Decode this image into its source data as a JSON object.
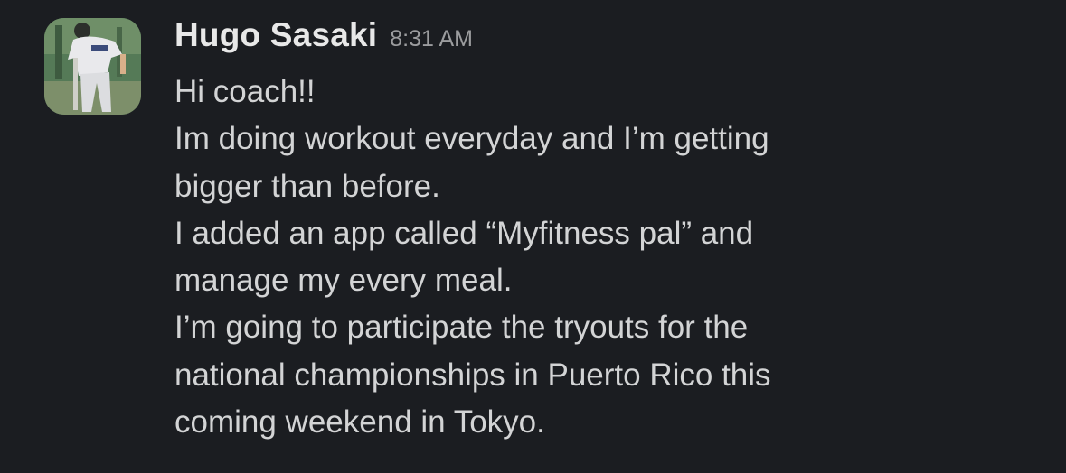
{
  "message": {
    "sender": "Hugo Sasaki",
    "timestamp": "8:31 AM",
    "avatar_icon": "user-avatar-photo",
    "lines": [
      "Hi coach!!",
      "Im doing workout everyday and I’m getting",
      "bigger than before.",
      "I added an app called “Myfitness pal” and",
      "manage my every meal.",
      "I’m going to participate the tryouts for the",
      "national championships in Puerto Rico this",
      "coming weekend in Tokyo."
    ]
  },
  "colors": {
    "background": "#1b1d21",
    "sender": "#e8e8e8",
    "timestamp": "#9b9c9e",
    "body_text": "#d3d4d5"
  }
}
